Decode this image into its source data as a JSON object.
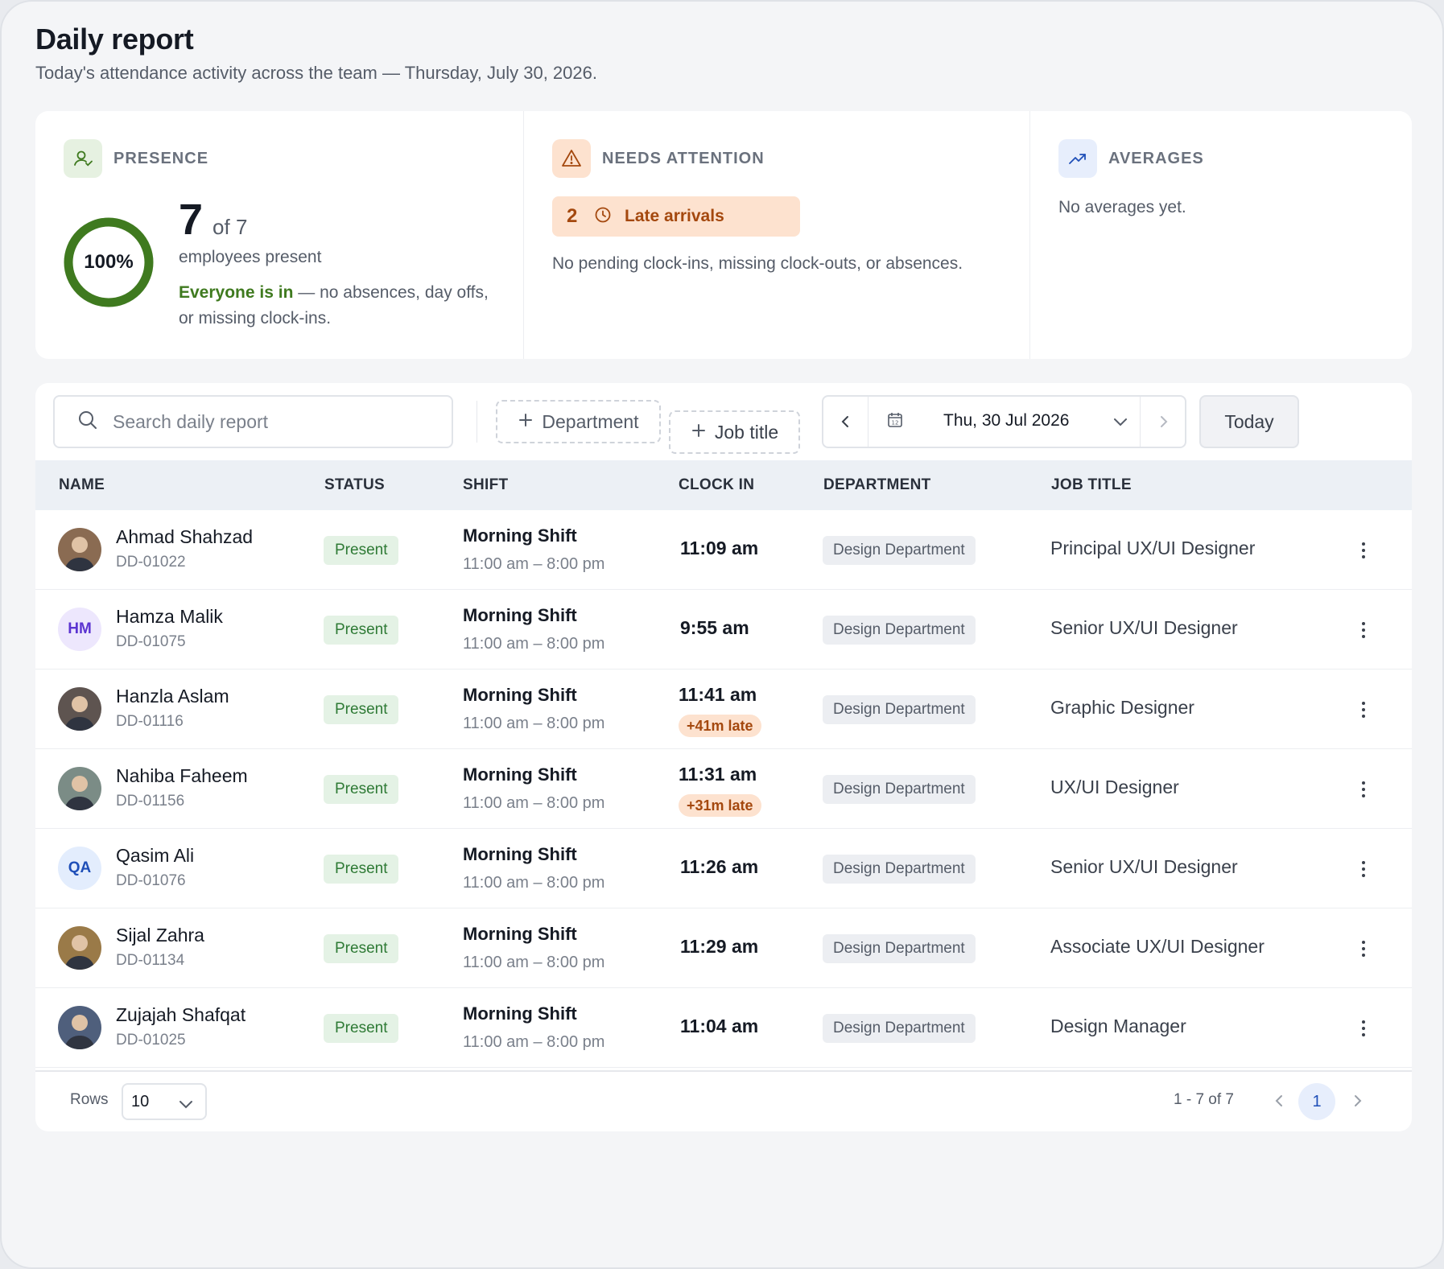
{
  "header": {
    "title": "Daily report",
    "subtitle": "Today's attendance activity across the team — Thursday, July 30, 2026."
  },
  "summary": {
    "presence": {
      "label": "PRESENCE",
      "percent_text": "100%",
      "percent_value": 1.0,
      "present": "7",
      "of_total": "of 7",
      "caption": "employees present",
      "note_strong": "Everyone is in",
      "note_rest": " — no absences, day offs, or missing clock-ins."
    },
    "attention": {
      "label": "NEEDS ATTENTION",
      "late_count": "2",
      "late_label": "Late arrivals",
      "note": "No pending clock-ins, missing clock-outs, or absences."
    },
    "averages": {
      "label": "AVERAGES",
      "note": "No averages yet."
    }
  },
  "toolbar": {
    "search_placeholder": "Search daily report",
    "department_filter": "Department",
    "job_title_filter": "Job title",
    "date": "Thu, 30 Jul 2026",
    "today": "Today"
  },
  "table": {
    "columns": [
      "NAME",
      "STATUS",
      "SHIFT",
      "CLOCK IN",
      "DEPARTMENT",
      "JOB TITLE"
    ],
    "rows": [
      {
        "name": "Ahmad Shahzad",
        "code": "DD-01022",
        "avatar": "photo",
        "status": "Present",
        "shift": "Morning Shift",
        "shift_time": "11:00 am – 8:00 pm",
        "clock_in": "11:09 am",
        "late": "",
        "department": "Design Department",
        "job_title": "Principal UX/UI Designer"
      },
      {
        "name": "Hamza Malik",
        "code": "DD-01075",
        "avatar": "HM",
        "status": "Present",
        "shift": "Morning Shift",
        "shift_time": "11:00 am – 8:00 pm",
        "clock_in": "9:55 am",
        "late": "",
        "department": "Design Department",
        "job_title": "Senior UX/UI Designer"
      },
      {
        "name": "Hanzla Aslam",
        "code": "DD-01116",
        "avatar": "photo",
        "status": "Present",
        "shift": "Morning Shift",
        "shift_time": "11:00 am – 8:00 pm",
        "clock_in": "11:41 am",
        "late": "+41m late",
        "department": "Design Department",
        "job_title": "Graphic Designer"
      },
      {
        "name": "Nahiba Faheem",
        "code": "DD-01156",
        "avatar": "photo",
        "status": "Present",
        "shift": "Morning Shift",
        "shift_time": "11:00 am – 8:00 pm",
        "clock_in": "11:31 am",
        "late": "+31m late",
        "department": "Design Department",
        "job_title": "UX/UI Designer"
      },
      {
        "name": "Qasim Ali",
        "code": "DD-01076",
        "avatar": "QA",
        "status": "Present",
        "shift": "Morning Shift",
        "shift_time": "11:00 am – 8:00 pm",
        "clock_in": "11:26 am",
        "late": "",
        "department": "Design Department",
        "job_title": "Senior UX/UI Designer"
      },
      {
        "name": "Sijal Zahra",
        "code": "DD-01134",
        "avatar": "photo",
        "status": "Present",
        "shift": "Morning Shift",
        "shift_time": "11:00 am – 8:00 pm",
        "clock_in": "11:29 am",
        "late": "",
        "department": "Design Department",
        "job_title": "Associate UX/UI Designer"
      },
      {
        "name": "Zujajah Shafqat",
        "code": "DD-01025",
        "avatar": "photo",
        "status": "Present",
        "shift": "Morning Shift",
        "shift_time": "11:00 am – 8:00 pm",
        "clock_in": "11:04 am",
        "late": "",
        "department": "Design Department",
        "job_title": "Design Manager"
      }
    ]
  },
  "footer": {
    "rows_label": "Rows",
    "rows_value": "10",
    "range": "1 - 7 of 7",
    "current_page": "1"
  },
  "colors": {
    "accent_green": "#3f7a1f",
    "late_orange": "#a4480e",
    "page_blue": "#1f4fb8"
  }
}
